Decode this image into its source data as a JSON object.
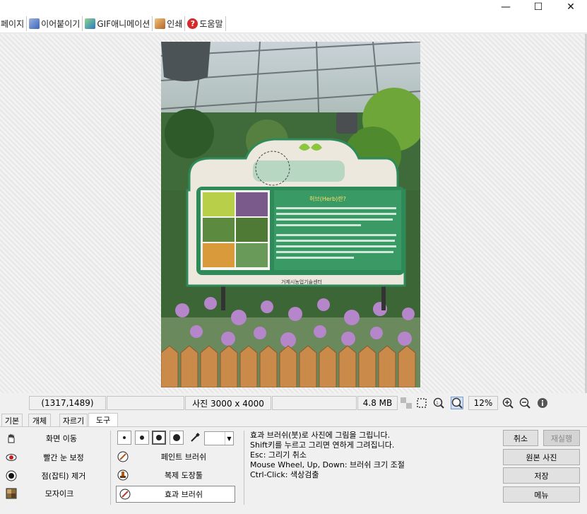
{
  "window": {
    "minimize_glyph": "—",
    "maximize_glyph": "☐",
    "close_glyph": "✕"
  },
  "toolbar": {
    "items": [
      {
        "label": "페이지",
        "icon": "page-icon"
      },
      {
        "label": "이어붙이기",
        "icon": "merge-icon"
      },
      {
        "label": "GIF애니메이션",
        "icon": "gif-animation-icon"
      },
      {
        "label": "인쇄",
        "icon": "print-icon"
      },
      {
        "label": "도움말",
        "icon": "help-icon"
      }
    ]
  },
  "image": {
    "sign_heading": "허브(Herb)란?",
    "sign_org": "거제시농업기술센터"
  },
  "statusbar": {
    "coordinates": "(1317,1489)",
    "photo_size": "사진 3000 x 4000",
    "file_size": "4.8 MB",
    "zoom": "12%"
  },
  "tabs": [
    "기본",
    "개체",
    "자르기",
    "도구"
  ],
  "active_tab": "도구",
  "tools_left": [
    {
      "label": "화면 이동",
      "icon": "hand-icon"
    },
    {
      "label": "빨간 눈 보정",
      "icon": "red-eye-icon"
    },
    {
      "label": "점(잡티) 제거",
      "icon": "spot-remove-icon"
    },
    {
      "label": "모자이크",
      "icon": "mosaic-icon"
    }
  ],
  "tools_right": [
    {
      "label": "페인트 브러쉬",
      "icon": "paint-brush-icon"
    },
    {
      "label": "복제 도장툴",
      "icon": "clone-stamp-icon"
    },
    {
      "label": "효과 브러쉬",
      "icon": "effect-brush-icon"
    }
  ],
  "help_lines": [
    "효과 브러쉬(붓)로 사진에 그림을 그립니다.",
    "Shift키를 누르고 그리면 연하게 그려집니다.",
    "Esc: 그리기 취소",
    "Mouse Wheel, Up, Down: 브러쉬 크기 조절",
    "Ctrl-Click: 색상검출"
  ],
  "buttons": {
    "cancel": "취소",
    "redo": "재실행",
    "original": "원본 사진",
    "save": "저장",
    "menu": "메뉴"
  },
  "colors": {
    "accent": "#2f8a5a",
    "border": "#adadad"
  }
}
